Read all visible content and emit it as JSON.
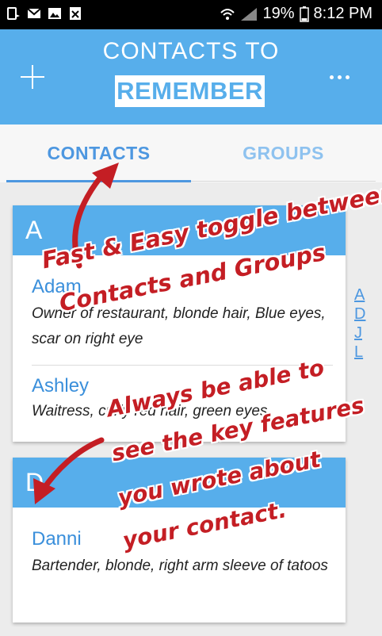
{
  "status_bar": {
    "battery": "19%",
    "time": "8:12 PM"
  },
  "app_bar": {
    "title_line1": "CONTACTS TO",
    "title_line2": "REMEMBER"
  },
  "tabs": [
    {
      "label": "CONTACTS",
      "active": true
    },
    {
      "label": "GROUPS",
      "active": false
    }
  ],
  "sections": [
    {
      "letter": "A",
      "contacts": [
        {
          "name": "Adam",
          "description": "Owner of restaurant, blonde hair, Blue eyes, scar on right eye"
        },
        {
          "name": "Ashley",
          "description": "Waitress, curly red hair, green eyes"
        }
      ]
    },
    {
      "letter": "D",
      "contacts": [
        {
          "name": "Danni",
          "description": "Bartender, blonde, right arm sleeve of tatoos"
        }
      ]
    }
  ],
  "index": [
    "A",
    "D",
    "J",
    "L"
  ],
  "annotations": {
    "toggle_line1": "Fast & Easy toggle between",
    "toggle_line2": "Contacts and Groups",
    "features_line1": "Always be able to",
    "features_line2": "see the key features",
    "features_line3": "you wrote about",
    "features_line4": "your contact."
  },
  "colors": {
    "accent": "#57aeeb",
    "active_tab": "#4d97e0",
    "annotation": "#c41e24"
  }
}
